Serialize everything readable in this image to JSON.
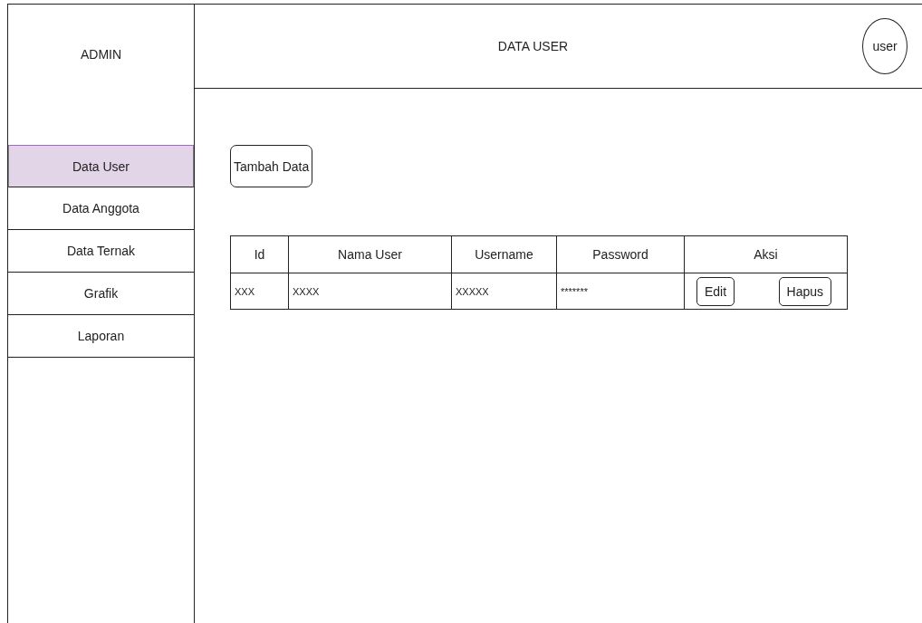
{
  "sidebar": {
    "title": "ADMIN",
    "items": [
      {
        "label": "Data User",
        "selected": true
      },
      {
        "label": "Data Anggota",
        "selected": false
      },
      {
        "label": "Data Ternak",
        "selected": false
      },
      {
        "label": "Grafik",
        "selected": false
      },
      {
        "label": "Laporan",
        "selected": false
      }
    ]
  },
  "header": {
    "title": "DATA USER",
    "avatar": "user"
  },
  "add_button": "Tambah Data",
  "table": {
    "columns": [
      "Id",
      "Nama User",
      "Username",
      "Password",
      "Aksi"
    ],
    "rows": [
      {
        "cells": [
          "XXX",
          "XXXX",
          "XXXXX",
          "*******"
        ],
        "actions": [
          "Edit",
          "Hapus"
        ]
      }
    ]
  }
}
